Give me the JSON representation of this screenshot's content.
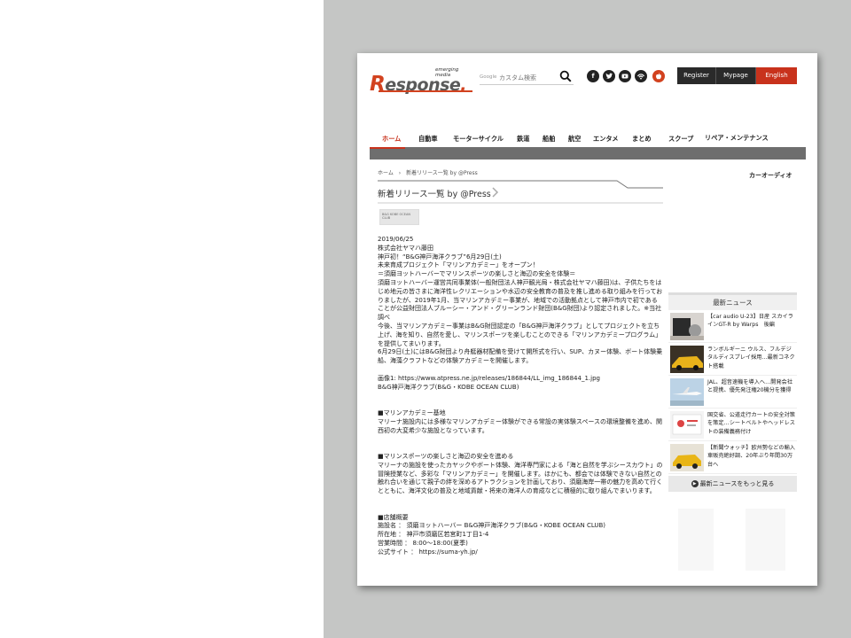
{
  "header": {
    "logo_tagline": "emerging media",
    "logo_r": "R",
    "logo_rest": "esponse",
    "logo_dot": ".",
    "search_label": "Google",
    "search_placeholder": "カスタム検索",
    "buttons": [
      "Register",
      "Mypage",
      "English"
    ]
  },
  "social_icons": [
    "facebook-icon",
    "twitter-icon",
    "youtube-icon",
    "rss-icon",
    "apple-icon"
  ],
  "nav": {
    "items": [
      "ホーム",
      "自動車",
      "モーターサイクル",
      "鉄道",
      "船舶",
      "航空",
      "エンタメ",
      "まとめ",
      "スクープ",
      "リペア・メンテナンス"
    ],
    "sub_item": "カーオーディオ"
  },
  "breadcrumb": [
    "ホーム",
    "›",
    "新着リリース一覧 by @Press"
  ],
  "section_title": "新着リリース一覧 by @Press",
  "article": {
    "date": "2019/06/25",
    "company": "株式会社ヤマハ藤田",
    "headline1": "神戸初！“B&G神戸海洋クラブ”6月29日(土)",
    "headline2": "未来育成プロジェクト「マリンアカデミー」をオープン！",
    "headline3": "＝須磨ヨットハーバーでマリンスポーツの楽しさと海辺の安全を体験＝",
    "body1": "須磨ヨットハーバー運営共同事業体(一般財団法人神戸観光局・株式会社ヤマハ藤田)は、子供たちをはじめ地元の皆さまに海洋性レクリエーションや水辺の安全教育の普及を推し進める取り組みを行っておりましたが、2019年1月、当マリンアカデミー事業が、地域での活動拠点として神戸市内で初であることが公益財団法人ブルーシー・アンド・グリーンランド財団(B&G財団)より認定されました。※当社調べ",
    "body2": "今後、当マリンアカデミー事業はB&G財団認定の「B&G神戸海洋クラブ」としてプロジェクトを立ち上げ、海を知り、自然を愛し、マリンスポーツを楽しむことのできる「マリンアカデミープログラム」を提供してまいります。",
    "body3": "6月29日(土)にはB&G財団より舟艇器材配備を受けて開所式を行い、SUP、カヌー体験、ボート体験乗船、海藻クラフトなどの体験アカデミーを開催します。",
    "image_caption1": "画像1: https://www.atpress.ne.jp/releases/186844/LL_img_186844_1.jpg",
    "image_caption2": "B&G神戸海洋クラブ(B&G・KOBE OCEAN CLUB)",
    "heading_base": "■マリンアカデミー基地",
    "base_text": "マリーナ施設内には多様なマリンアカデミー体験ができる常設の実体験スペースの環境整備を進め、関西初の大変希少な施設となっています。",
    "heading_sports": "■マリンスポーツの楽しさと海辺の安全を進める",
    "sports_text": "マリーナの施設を使ったカヤックやボート体験、海洋専門家による「海と自然を学ぶシースカウト」の冒険授業など、多彩な「マリンアカデミー」を開催します。ほかにも、都会では体験できない自然との触れ合いを通じて親子の絆を深めるアトラクションを計画しており、須磨海岸一帯の魅力を高めて行くとともに、海洋文化の普及と地域貢献・将来の海洋人の育成などに積極的に取り組んでまいります。",
    "heading_store": "■店舗概要",
    "store_name": "施設名 ： 須磨ヨットハーバー B&G神戸海洋クラブ(B&G・KOBE OCEAN CLUB)",
    "store_address": "所在地 ： 神戸市須磨区若宮町1丁目1-4",
    "store_hours": "営業時間 ： 8:00〜18:00(夏季)",
    "store_site": "公式サイト ： https://suma-yh.jp/"
  },
  "press_logo_text": "B&G KOBE OCEAN CLUB",
  "sidebar": {
    "title": "最新ニュース",
    "news": [
      "【car audio U-23】日産 スカイラインGT-R by Warps　後編",
      "ランボルギーニ ウルス、フルデジタルディスプレイ採用…最新コネクト搭載",
      "JAL、超音速機を導入へ…開発会社と提携、優先発注権20機分を獲得",
      "国交省、公道走行カートの安全対策を策定…シートベルトやヘッドレストの装備義務付け",
      "【新聞ウォッチ】欧州勢などの輸入車販売絶好調、20年ぶり年間30万台へ"
    ],
    "more_label": "最新ニュースをもっと見る"
  }
}
